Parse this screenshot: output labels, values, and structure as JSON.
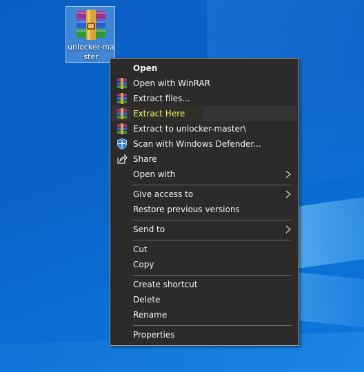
{
  "desktop": {
    "icon_label": "unlocker-master"
  },
  "context_menu": {
    "items": [
      {
        "label": "Open"
      },
      {
        "label": "Open with WinRAR"
      },
      {
        "label": "Extract files..."
      },
      {
        "label": "Extract Here"
      },
      {
        "label": "Extract to unlocker-master\\"
      },
      {
        "label": "Scan with Windows Defender..."
      },
      {
        "label": "Share"
      },
      {
        "label": "Open with"
      },
      {
        "label": "Give access to"
      },
      {
        "label": "Restore previous versions"
      },
      {
        "label": "Send to"
      },
      {
        "label": "Cut"
      },
      {
        "label": "Copy"
      },
      {
        "label": "Create shortcut"
      },
      {
        "label": "Delete"
      },
      {
        "label": "Rename"
      },
      {
        "label": "Properties"
      }
    ],
    "highlighted": "Extract Here"
  },
  "colors": {
    "menu_background": "#2b2b2b",
    "menu_text": "#f2f2f2",
    "highlight_text": "#f4f27a",
    "desktop_blue": "#0b63c8"
  }
}
